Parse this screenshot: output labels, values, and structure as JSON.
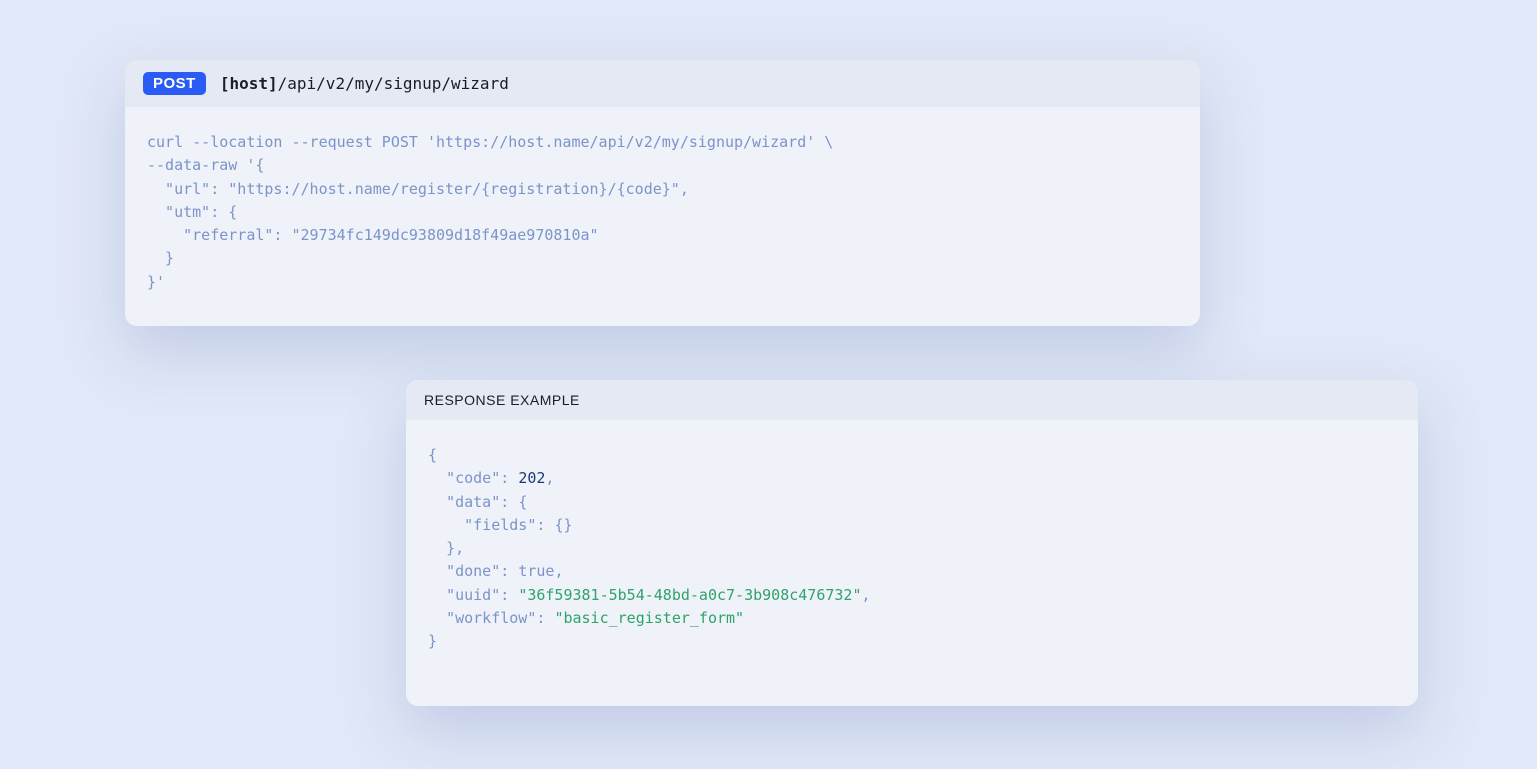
{
  "request": {
    "method": "POST",
    "host_label": "[host]",
    "path": "/api/v2/my/signup/wizard",
    "curl_text": "curl --location --request POST 'https://host.name/api/v2/my/signup/wizard' \\\n--data-raw '{\n  \"url\": \"https://host.name/register/{registration}/{code}\",\n  \"utm\": {\n    \"referral\": \"29734fc149dc93809d18f49ae970810a\"\n  }\n}'"
  },
  "response": {
    "header": "RESPONSE EXAMPLE",
    "json_lines": [
      {
        "indent": 0,
        "type": "punc",
        "text": "{"
      },
      {
        "indent": 1,
        "type": "kv",
        "key": "\"code\"",
        "sep": ": ",
        "value": "202",
        "vtype": "num",
        "trail": ","
      },
      {
        "indent": 1,
        "type": "kv",
        "key": "\"data\"",
        "sep": ": ",
        "value": "{",
        "vtype": "punc",
        "trail": ""
      },
      {
        "indent": 2,
        "type": "kv",
        "key": "\"fields\"",
        "sep": ": ",
        "value": "{}",
        "vtype": "punc",
        "trail": ""
      },
      {
        "indent": 1,
        "type": "punc",
        "text": "},"
      },
      {
        "indent": 1,
        "type": "kv",
        "key": "\"done\"",
        "sep": ": ",
        "value": "true",
        "vtype": "punc",
        "trail": ","
      },
      {
        "indent": 1,
        "type": "kv",
        "key": "\"uuid\"",
        "sep": ": ",
        "value": "\"36f59381-5b54-48bd-a0c7-3b908c476732\"",
        "vtype": "str",
        "trail": ","
      },
      {
        "indent": 1,
        "type": "kv",
        "key": "\"workflow\"",
        "sep": ": ",
        "value": "\"basic_register_form\"",
        "vtype": "str",
        "trail": ""
      },
      {
        "indent": 0,
        "type": "punc",
        "text": "}"
      }
    ]
  }
}
